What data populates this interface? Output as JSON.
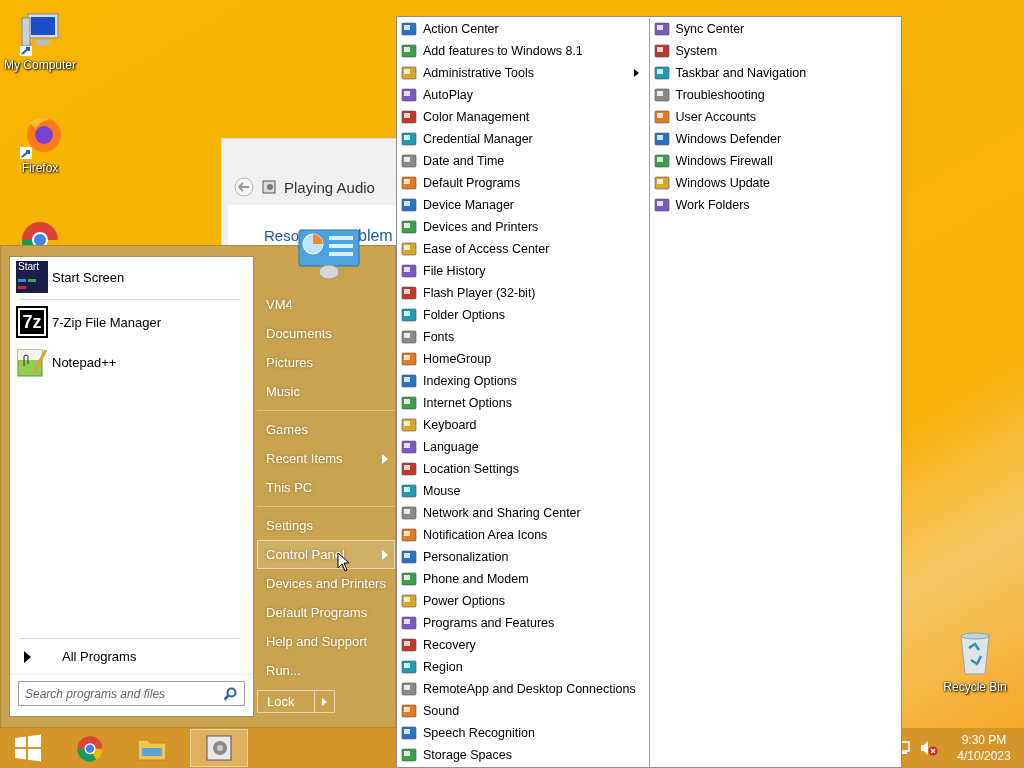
{
  "desktop_icons": [
    {
      "kind": "computer",
      "label": "My Computer"
    },
    {
      "kind": "firefox",
      "label": "Firefox"
    },
    {
      "kind": "chrome"
    }
  ],
  "recycle_bin": {
    "label": "Recycle Bin"
  },
  "background_window": {
    "title": "Playing Audio",
    "fragments": [
      "Reso",
      "blem"
    ]
  },
  "start_menu": {
    "pinned": [
      {
        "kind": "start",
        "label": "Start Screen",
        "icon_text": "Start"
      },
      {
        "kind": "sevenzip",
        "label": "7-Zip File Manager",
        "icon_text": "7z"
      },
      {
        "kind": "notepad",
        "label": "Notepad++"
      }
    ],
    "all_programs": "All Programs",
    "search": {
      "placeholder": "Search programs and files"
    },
    "places": [
      [
        {
          "label": "VM4",
          "submenu": false,
          "selected": false
        },
        {
          "label": "Documents",
          "submenu": false,
          "selected": false
        },
        {
          "label": "Pictures",
          "submenu": false,
          "selected": false
        },
        {
          "label": "Music",
          "submenu": false,
          "selected": false
        }
      ],
      [
        {
          "label": "Games",
          "submenu": false,
          "selected": false
        },
        {
          "label": "Recent Items",
          "submenu": true,
          "selected": false
        },
        {
          "label": "This PC",
          "submenu": false,
          "selected": false
        }
      ],
      [
        {
          "label": "Settings",
          "submenu": false,
          "selected": false
        },
        {
          "label": "Control Panel",
          "submenu": true,
          "selected": true
        },
        {
          "label": "Devices and Printers",
          "submenu": false,
          "selected": false
        },
        {
          "label": "Default Programs",
          "submenu": false,
          "selected": false
        },
        {
          "label": "Help and Support",
          "submenu": false,
          "selected": false
        },
        {
          "label": "Run...",
          "submenu": false,
          "selected": false
        }
      ]
    ],
    "lock_button": "Lock"
  },
  "control_panel_menu": {
    "columns": [
      [
        {
          "label": "Action Center",
          "submenu": false
        },
        {
          "label": "Add features to Windows 8.1",
          "submenu": false
        },
        {
          "label": "Administrative Tools",
          "submenu": true
        },
        {
          "label": "AutoPlay",
          "submenu": false
        },
        {
          "label": "Color Management",
          "submenu": false
        },
        {
          "label": "Credential Manager",
          "submenu": false
        },
        {
          "label": "Date and Time",
          "submenu": false
        },
        {
          "label": "Default Programs",
          "submenu": false
        },
        {
          "label": "Device Manager",
          "submenu": false
        },
        {
          "label": "Devices and Printers",
          "submenu": false
        },
        {
          "label": "Ease of Access Center",
          "submenu": false
        },
        {
          "label": "File History",
          "submenu": false
        },
        {
          "label": "Flash Player (32-bit)",
          "submenu": false
        },
        {
          "label": "Folder Options",
          "submenu": false
        },
        {
          "label": "Fonts",
          "submenu": false
        },
        {
          "label": "HomeGroup",
          "submenu": false
        },
        {
          "label": "Indexing Options",
          "submenu": false
        },
        {
          "label": "Internet Options",
          "submenu": false
        },
        {
          "label": "Keyboard",
          "submenu": false
        },
        {
          "label": "Language",
          "submenu": false
        },
        {
          "label": "Location Settings",
          "submenu": false
        },
        {
          "label": "Mouse",
          "submenu": false
        },
        {
          "label": "Network and Sharing Center",
          "submenu": false
        },
        {
          "label": "Notification Area Icons",
          "submenu": false
        },
        {
          "label": "Personalization",
          "submenu": false
        },
        {
          "label": "Phone and Modem",
          "submenu": false
        },
        {
          "label": "Power Options",
          "submenu": false
        },
        {
          "label": "Programs and Features",
          "submenu": false
        },
        {
          "label": "Recovery",
          "submenu": false
        },
        {
          "label": "Region",
          "submenu": false
        },
        {
          "label": "RemoteApp and Desktop Connections",
          "submenu": false
        },
        {
          "label": "Sound",
          "submenu": false
        },
        {
          "label": "Speech Recognition",
          "submenu": false
        },
        {
          "label": "Storage Spaces",
          "submenu": false
        }
      ],
      [
        {
          "label": "Sync Center",
          "submenu": false
        },
        {
          "label": "System",
          "submenu": false
        },
        {
          "label": "Taskbar and Navigation",
          "submenu": false
        },
        {
          "label": "Troubleshooting",
          "submenu": false
        },
        {
          "label": "User Accounts",
          "submenu": false
        },
        {
          "label": "Windows Defender",
          "submenu": false
        },
        {
          "label": "Windows Firewall",
          "submenu": false
        },
        {
          "label": "Windows Update",
          "submenu": false
        },
        {
          "label": "Work Folders",
          "submenu": false
        }
      ]
    ]
  },
  "taskbar": {
    "buttons": [
      {
        "kind": "start",
        "active": false
      },
      {
        "kind": "chrome",
        "active": false
      },
      {
        "kind": "explorer",
        "active": false
      },
      {
        "kind": "audio",
        "active": true
      }
    ],
    "clock": {
      "time": "9:30 PM",
      "date": "4/10/2023"
    }
  }
}
